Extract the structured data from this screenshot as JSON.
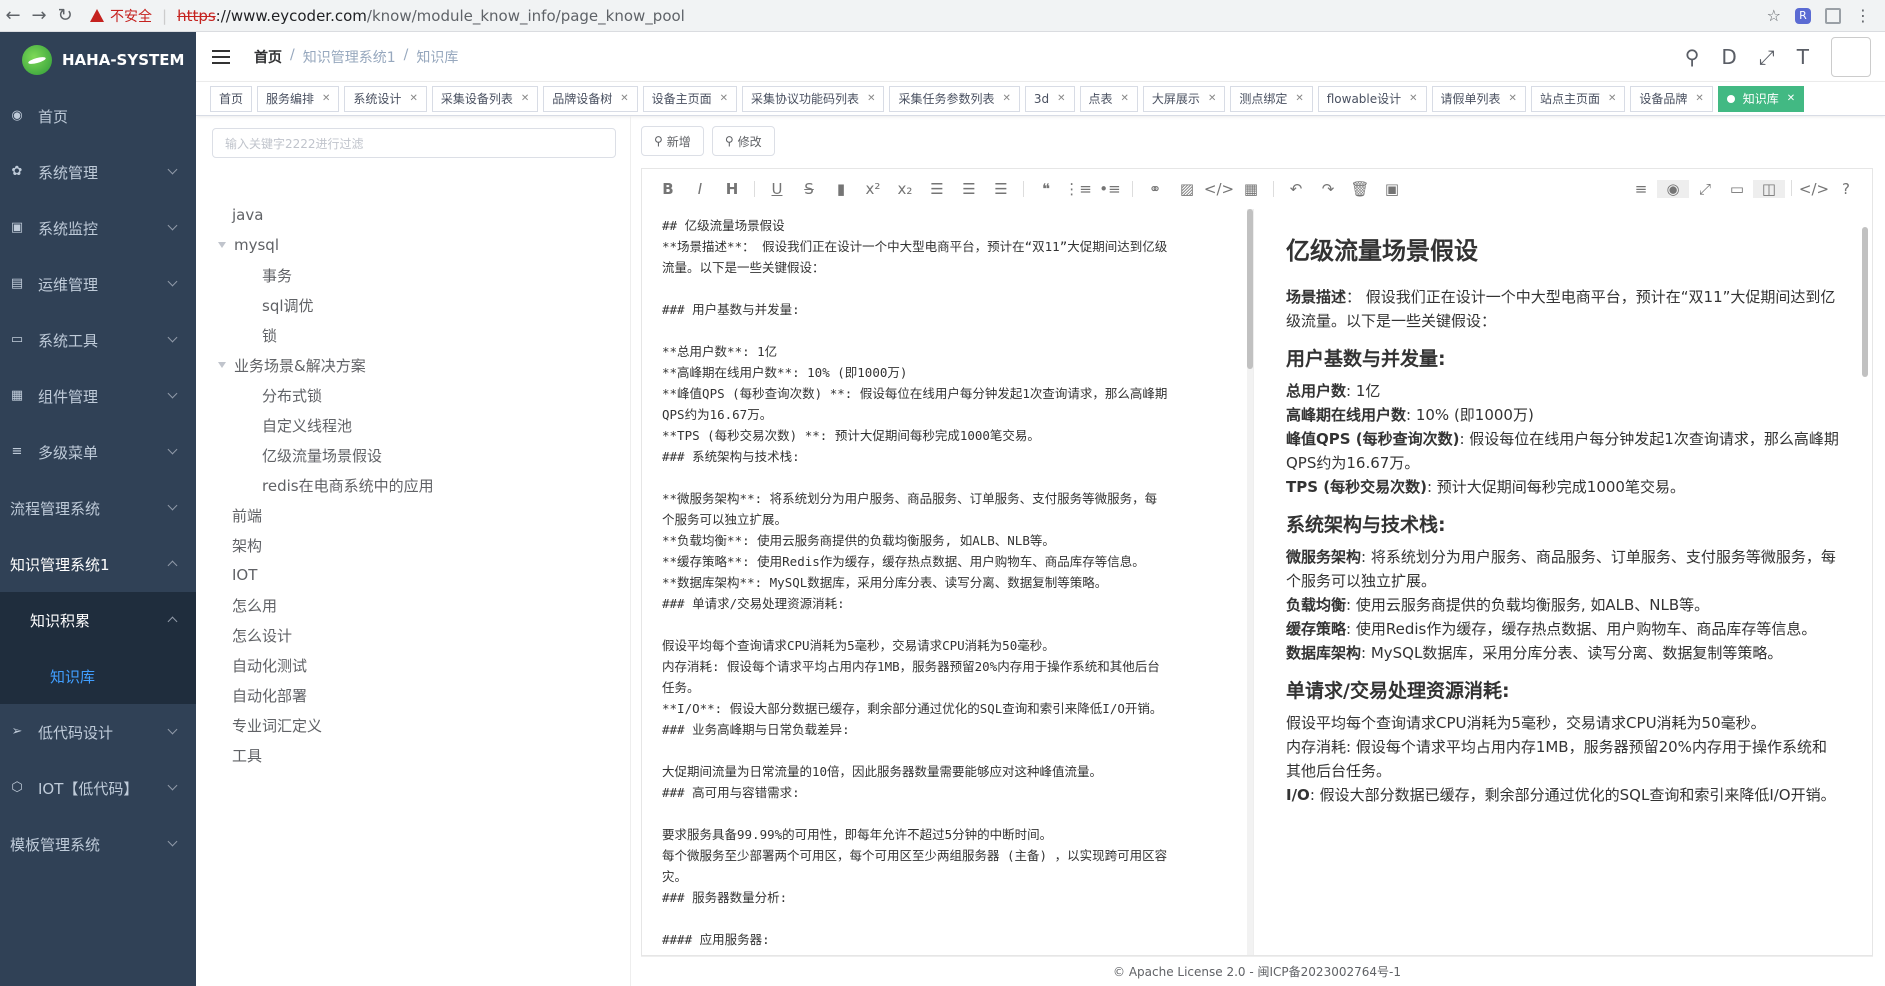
{
  "browser": {
    "warning": "不安全",
    "url_scheme": "https",
    "url_host": "://www.eycoder.com",
    "url_path": "/know/module_know_info/page_know_pool"
  },
  "sidebar": {
    "logo": "HAHA-SYSTEM",
    "items": [
      {
        "label": "首页",
        "icon": "dashboard-icon"
      },
      {
        "label": "系统管理",
        "icon": "gear-icon"
      },
      {
        "label": "系统监控",
        "icon": "monitor-icon"
      },
      {
        "label": "运维管理",
        "icon": "server-icon"
      },
      {
        "label": "系统工具",
        "icon": "tool-icon"
      },
      {
        "label": "组件管理",
        "icon": "grid-icon"
      },
      {
        "label": "多级菜单",
        "icon": "list-icon"
      },
      {
        "label": "流程管理系统",
        "icon": ""
      },
      {
        "label": "知识管理系统1",
        "icon": ""
      }
    ],
    "sub_item": "知识积累",
    "sub_sub_item": "知识库",
    "bottom_items": [
      {
        "label": "低代码设计",
        "icon": "send-icon"
      },
      {
        "label": "IOT【低代码】",
        "icon": "cube-icon"
      },
      {
        "label": "模板管理系统",
        "icon": ""
      }
    ]
  },
  "breadcrumb": [
    "首页",
    "知识管理系统1",
    "知识库"
  ],
  "tags": [
    "首页",
    "服务编排",
    "系统设计",
    "采集设备列表",
    "品牌设备树",
    "设备主页面",
    "采集协议功能码列表",
    "采集任务参数列表",
    "3d",
    "点表",
    "大屏展示",
    "测点绑定",
    "flowable设计",
    "请假单列表",
    "站点主页面",
    "设备品牌"
  ],
  "active_tag": "知识库",
  "filter_placeholder": "输入关键字2222进行过滤",
  "tree": [
    {
      "label": "java",
      "level": 0,
      "expanded": false
    },
    {
      "label": "mysql",
      "level": 0,
      "expanded": true
    },
    {
      "label": "事务",
      "level": 1
    },
    {
      "label": "sql调优",
      "level": 1
    },
    {
      "label": "锁",
      "level": 1
    },
    {
      "label": "业务场景&解决方案",
      "level": 0,
      "expanded": true
    },
    {
      "label": "分布式锁",
      "level": 1
    },
    {
      "label": "自定义线程池",
      "level": 1
    },
    {
      "label": "亿级流量场景假设",
      "level": 1
    },
    {
      "label": "redis在电商系统中的应用",
      "level": 1
    },
    {
      "label": "前端",
      "level": 0
    },
    {
      "label": "架构",
      "level": 0
    },
    {
      "label": "IOT",
      "level": 0
    },
    {
      "label": "怎么用",
      "level": 0
    },
    {
      "label": "怎么设计",
      "level": 0
    },
    {
      "label": "自动化测试",
      "level": 0
    },
    {
      "label": "自动化部署",
      "level": 0
    },
    {
      "label": "专业词汇定义",
      "level": 0
    },
    {
      "label": "工具",
      "level": 0
    }
  ],
  "buttons": {
    "add": "新增",
    "edit": "修改"
  },
  "source_lines": [
    "## 亿级流量场景假设",
    "**场景描述**： 假设我们正在设计一个中大型电商平台，预计在“双11”大促期间达到亿级",
    "流量。以下是一些关键假设：",
    "",
    "### 用户基数与并发量:",
    "",
    "**总用户数**: 1亿",
    "**高峰期在线用户数**: 10% (即1000万)",
    "**峰值QPS (每秒查询次数) **: 假设每位在线用户每分钟发起1次查询请求，那么高峰期",
    "QPS约为16.67万。",
    "**TPS (每秒交易次数) **: 预计大促期间每秒完成1000笔交易。",
    "### 系统架构与技术栈:",
    "",
    "**微服务架构**: 将系统划分为用户服务、商品服务、订单服务、支付服务等微服务，每",
    "个服务可以独立扩展。",
    "**负载均衡**: 使用云服务商提供的负载均衡服务, 如ALB、NLB等。",
    "**缓存策略**: 使用Redis作为缓存，缓存热点数据、用户购物车、商品库存等信息。",
    "**数据库架构**: MySQL数据库，采用分库分表、读写分离、数据复制等策略。",
    "### 单请求/交易处理资源消耗:",
    "",
    "假设平均每个查询请求CPU消耗为5毫秒，交易请求CPU消耗为50毫秒。",
    "内存消耗: 假设每个请求平均占用内存1MB，服务器预留20%内存用于操作系统和其他后台",
    "任务。",
    "**I/O**: 假设大部分数据已缓存，剩余部分通过优化的SQL查询和索引来降低I/O开销。",
    "### 业务高峰期与日常负载差异:",
    "",
    "大促期间流量为日常流量的10倍，因此服务器数量需要能够应对这种峰值流量。",
    "### 高可用与容错需求:",
    "",
    "要求服务具备99.99%的可用性，即每年允许不超过5分钟的中断时间。",
    "每个微服务至少部署两个可用区，每个可用区至少两组服务器 (主备) ，以实现跨可用区容",
    "灾。",
    "### 服务器数量分析:",
    "",
    "#### 应用服务器:"
  ],
  "preview": {
    "title": "亿级流量场景假设",
    "scene_label": "场景描述",
    "scene_text": "： 假设我们正在设计一个中大型电商平台，预计在“双11”大促期间达到亿级流量。以下是一些关键假设：",
    "h_users": "用户基数与并发量:",
    "users": [
      {
        "k": "总用户数",
        "v": ": 1亿"
      },
      {
        "k": "高峰期在线用户数",
        "v": ": 10% (即1000万)"
      },
      {
        "k": "峰值QPS (每秒查询次数)",
        "v": ": 假设每位在线用户每分钟发起1次查询请求，那么高峰期QPS约为16.67万。"
      },
      {
        "k": "TPS (每秒交易次数)",
        "v": ": 预计大促期间每秒完成1000笔交易。"
      }
    ],
    "h_arch": "系统架构与技术栈:",
    "arch": [
      {
        "k": "微服务架构",
        "v": ": 将系统划分为用户服务、商品服务、订单服务、支付服务等微服务，每个服务可以独立扩展。"
      },
      {
        "k": "负载均衡",
        "v": ": 使用云服务商提供的负载均衡服务, 如ALB、NLB等。"
      },
      {
        "k": "缓存策略",
        "v": ": 使用Redis作为缓存，缓存热点数据、用户购物车、商品库存等信息。"
      },
      {
        "k": "数据库架构",
        "v": ": MySQL数据库，采用分库分表、读写分离、数据复制等策略。"
      }
    ],
    "h_res": "单请求/交易处理资源消耗:",
    "res1": "假设平均每个查询请求CPU消耗为5毫秒，交易请求CPU消耗为50毫秒。",
    "res2": "内存消耗: 假设每个请求平均占用内存1MB，服务器预留20%内存用于操作系统和其他后台任务。",
    "res3_k": "I/O",
    "res3_v": ": 假设大部分数据已缓存，剩余部分通过优化的SQL查询和索引来降低I/O开销。"
  },
  "footer": "© Apache License 2.0 - 闽ICP备2023002764号-1"
}
